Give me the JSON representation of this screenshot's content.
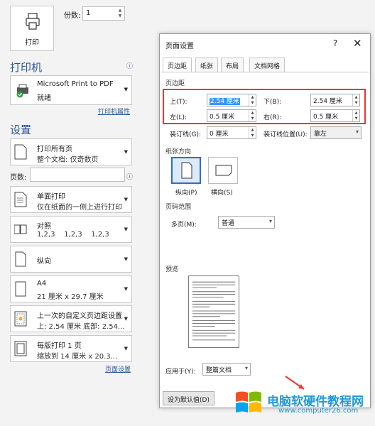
{
  "print_button": {
    "label": "打印",
    "icon": "printer-icon"
  },
  "copies": {
    "label": "份数:",
    "value": "1"
  },
  "printer_section": {
    "title": "打印机",
    "name": "Microsoft Print to PDF",
    "status": "就绪",
    "properties_link": "打印机属性"
  },
  "settings_section": {
    "title": "设置",
    "pages_label": "页数:",
    "page_setup_link": "页面设置"
  },
  "options": [
    {
      "line1": "打印所有页",
      "line2": "整个文档: 仅奇数页"
    },
    {
      "line1": "单面打印",
      "line2": "仅在纸面的一侧上进行打印"
    },
    {
      "line1": "对照",
      "line2": "1,2,3    1,2,3    1,2,3"
    },
    {
      "line1": "纵向",
      "line2": ""
    },
    {
      "line1": "A4",
      "line2": "21 厘米 x 29.7 厘米"
    },
    {
      "line1": "上一次的自定义页边距设置",
      "line2": "上: 2.54 厘米 底部: 2.54..."
    },
    {
      "line1": "每版打印 1 页",
      "line2": "缩放到 14 厘米 x 20.3..."
    }
  ],
  "dialog": {
    "title": "页面设置",
    "help": "?",
    "close": "✕",
    "tabs": [
      "页边距",
      "纸张",
      "布局",
      "文档网格"
    ],
    "margins_group": "页边距",
    "top_label": "上(T):",
    "top_value": "2.54 厘米",
    "bottom_label": "下(B):",
    "bottom_value": "2.54 厘米",
    "left_label": "左(L):",
    "left_value": "0.5 厘米",
    "right_label": "右(R):",
    "right_value": "0.5 厘米",
    "gutter_label": "装订线(G):",
    "gutter_value": "0 厘米",
    "gutter_pos_label": "装订线位置(U):",
    "gutter_pos_value": "靠左",
    "orientation_group": "纸张方向",
    "portrait_label": "纵向(P)",
    "landscape_label": "横向(S)",
    "page_range_group": "页码范围",
    "multi_pages_label": "多页(M):",
    "multi_pages_value": "普通",
    "preview_group": "预览",
    "apply_to_label": "应用于(Y):",
    "apply_to_value": "整篇文档",
    "default_button": "设为默认值(D)"
  },
  "watermark": {
    "title": "电脑软硬件教程网",
    "url": "www.computer26.com"
  },
  "colors": {
    "accent": "#2b579a",
    "highlight": "#e53935",
    "selection": "#3399ff"
  }
}
